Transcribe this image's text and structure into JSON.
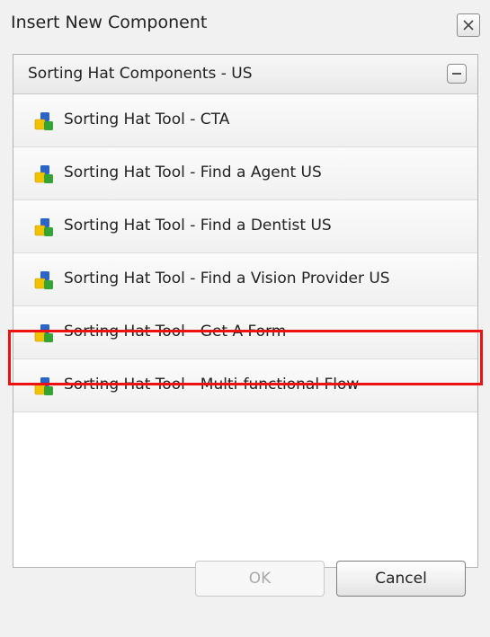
{
  "dialog": {
    "title": "Insert New Component"
  },
  "panel": {
    "title": "Sorting Hat Components - US",
    "items": [
      {
        "label": "Sorting Hat Tool - CTA"
      },
      {
        "label": "Sorting Hat Tool - Find a Agent US"
      },
      {
        "label": "Sorting Hat Tool - Find a Dentist US"
      },
      {
        "label": "Sorting Hat Tool - Find a Vision Provider US"
      },
      {
        "label": "Sorting Hat Tool - Get A Form"
      },
      {
        "label": "Sorting Hat Tool - Multi-functional Flow",
        "selected": true
      }
    ],
    "item_icon": "component-blocks-icon"
  },
  "buttons": {
    "ok_label": "OK",
    "ok_enabled": false,
    "cancel_label": "Cancel"
  },
  "colors": {
    "highlight": "#ee1111",
    "icon_blue": "#2a64c8",
    "icon_yellow": "#f2c200",
    "icon_green": "#34a534"
  }
}
